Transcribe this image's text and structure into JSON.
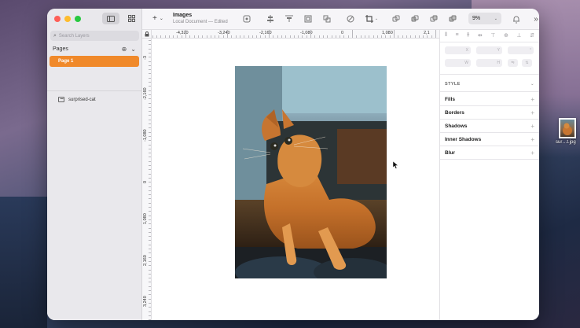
{
  "window": {
    "doc_title": "Images",
    "doc_subtitle": "Local Document — Edited"
  },
  "sidebar": {
    "search_placeholder": "Search Layers",
    "pages_label": "Pages",
    "pages": [
      {
        "label": "Page 1",
        "selected": true
      }
    ],
    "layers": [
      {
        "label": "surprised-cat",
        "icon": "image-icon"
      }
    ]
  },
  "toolbar": {
    "zoom": "9%",
    "icons": [
      "symbol-icon",
      "align-icon",
      "distribute-icon",
      "scale-icon",
      "flatten-icon",
      "rotate-icon",
      "crop-icon",
      "union-icon",
      "subtract-icon",
      "intersect-icon",
      "difference-icon",
      "bell-icon",
      "more-icon"
    ]
  },
  "ruler": {
    "top": [
      "-4,320",
      "-3,240",
      "-2,160",
      "-1,080",
      "0",
      "1,080",
      "2,1"
    ],
    "left": [
      "-3",
      "-2,160",
      "-1,080",
      "0",
      "1,080",
      "2,160",
      "3,240"
    ]
  },
  "inspector": {
    "style_label": "STYLE",
    "sections": [
      "Fills",
      "Borders",
      "Shadows",
      "Inner Shadows",
      "Blur"
    ]
  },
  "desktop_file": {
    "name": "sur…t.jpg"
  },
  "colors": {
    "accent": "#f0892a",
    "page_bg": "#ffffff"
  }
}
